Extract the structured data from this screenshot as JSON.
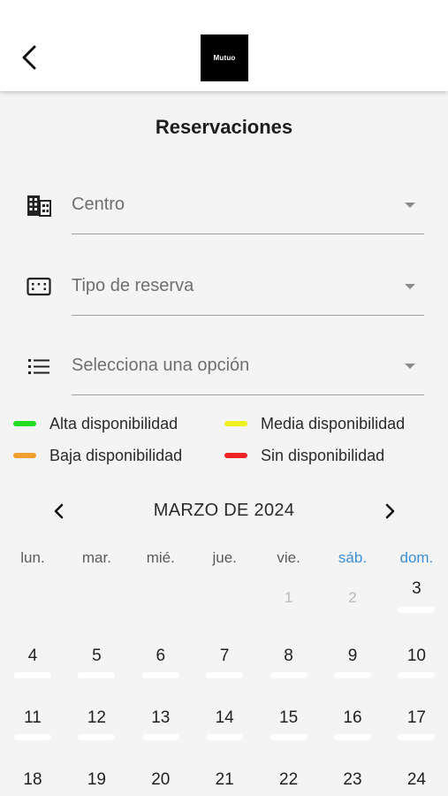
{
  "header": {
    "logo_text": "Mutuo",
    "back_icon": "chevron-left-icon"
  },
  "page": {
    "title": "Reservaciones"
  },
  "form": {
    "centro": {
      "placeholder": "Centro",
      "icon": "building-icon"
    },
    "tipo_reserva": {
      "placeholder": "Tipo de reserva",
      "icon": "keyboard-box-icon"
    },
    "opcion": {
      "placeholder": "Selecciona una opción",
      "icon": "list-icon"
    }
  },
  "legend": [
    {
      "label": "Alta disponibilidad",
      "color": "#22dd22"
    },
    {
      "label": "Media disponibilidad",
      "color": "#eef020"
    },
    {
      "label": "Baja disponibilidad",
      "color": "#f0a030"
    },
    {
      "label": "Sin disponibilidad",
      "color": "#ee2222"
    }
  ],
  "calendar": {
    "month_label": "MARZO DE 2024",
    "weekend_color": "#3b8fd8",
    "weekdays": [
      "lun.",
      "mar.",
      "mié.",
      "jue.",
      "vie.",
      "sáb.",
      "dom."
    ],
    "weeks": [
      [
        "",
        "",
        "",
        "",
        "1",
        "2",
        "3"
      ],
      [
        "4",
        "5",
        "6",
        "7",
        "8",
        "9",
        "10"
      ],
      [
        "11",
        "12",
        "13",
        "14",
        "15",
        "16",
        "17"
      ],
      [
        "18",
        "19",
        "20",
        "21",
        "22",
        "23",
        "24"
      ]
    ],
    "muted_days": [
      "1",
      "2"
    ]
  }
}
